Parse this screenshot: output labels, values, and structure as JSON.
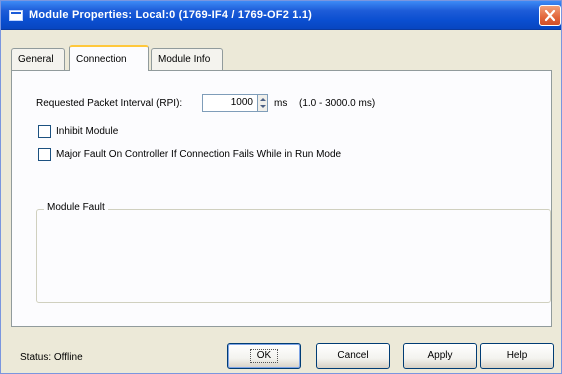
{
  "window": {
    "title": "Module Properties: Local:0 (1769-IF4 / 1769-OF2 1.1)"
  },
  "tabs": [
    {
      "label": "General"
    },
    {
      "label": "Connection"
    },
    {
      "label": "Module Info"
    }
  ],
  "active_tab": "Connection",
  "connection": {
    "rpi_label": "Requested Packet Interval (RPI):",
    "rpi_value": "1000",
    "rpi_unit": "ms",
    "rpi_range": "(1.0 - 3000.0 ms)",
    "inhibit_label": "Inhibit Module",
    "inhibit_checked": false,
    "major_fault_label": "Major Fault On Controller If Connection Fails While in Run Mode",
    "major_fault_checked": false,
    "module_fault_legend": "Module Fault"
  },
  "footer": {
    "status_text": "Status: Offline",
    "ok_label": "OK",
    "cancel_label": "Cancel",
    "apply_label": "Apply",
    "help_label": "Help"
  },
  "colors": {
    "titlebar": "#0A4ED0",
    "dialog_bg": "#ECE9D8",
    "panel_bg": "#FCFCFE",
    "active_tab_accent": "#FFC83C",
    "close_button": "#E2653A"
  },
  "icons": [
    "app-window-icon",
    "close-icon",
    "spinner-up-icon",
    "spinner-down-icon"
  ]
}
